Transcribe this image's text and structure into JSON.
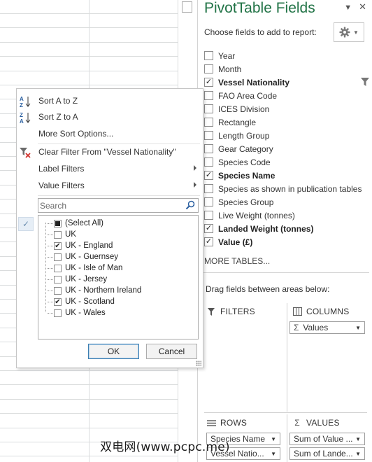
{
  "pivot_panel": {
    "title": "PivotTable Fields",
    "choose_text": "Choose fields to add to report:",
    "fields": [
      {
        "label": "Year",
        "checked": false,
        "bold": false
      },
      {
        "label": "Month",
        "checked": false,
        "bold": false
      },
      {
        "label": "Vessel Nationality",
        "checked": true,
        "bold": true,
        "filtered": true
      },
      {
        "label": "FAO Area Code",
        "checked": false,
        "bold": false
      },
      {
        "label": "ICES Division",
        "checked": false,
        "bold": false
      },
      {
        "label": "Rectangle",
        "checked": false,
        "bold": false
      },
      {
        "label": "Length Group",
        "checked": false,
        "bold": false
      },
      {
        "label": "Gear Category",
        "checked": false,
        "bold": false
      },
      {
        "label": "Species Code",
        "checked": false,
        "bold": false
      },
      {
        "label": "Species Name",
        "checked": true,
        "bold": true
      },
      {
        "label": "Species as shown in publication tables",
        "checked": false,
        "bold": false
      },
      {
        "label": "Species Group",
        "checked": false,
        "bold": false
      },
      {
        "label": "Live Weight (tonnes)",
        "checked": false,
        "bold": false
      },
      {
        "label": "Landed Weight (tonnes)",
        "checked": true,
        "bold": true
      },
      {
        "label": "Value (£)",
        "checked": true,
        "bold": true
      }
    ],
    "more_tables": "MORE TABLES...",
    "drag_text": "Drag fields between areas below:",
    "areas": {
      "filters": {
        "label": "FILTERS"
      },
      "columns": {
        "label": "COLUMNS",
        "chips": [
          "Values"
        ]
      },
      "rows": {
        "label": "ROWS",
        "chips": [
          "Species Name",
          "Vessel Natio..."
        ]
      },
      "values": {
        "label": "VALUES",
        "chips": [
          "Sum of Value ...",
          "Sum of Lande..."
        ]
      }
    }
  },
  "filter_menu": {
    "sort_az": "Sort A to Z",
    "sort_za": "Sort Z to A",
    "more_sort": "More Sort Options...",
    "clear_filter": "Clear Filter From \"Vessel Nationality\"",
    "label_filters": "Label Filters",
    "value_filters": "Value Filters",
    "search_placeholder": "Search",
    "values": [
      {
        "label": "(Select All)",
        "state": "partial"
      },
      {
        "label": "UK",
        "state": "unchecked"
      },
      {
        "label": "UK - England",
        "state": "checked"
      },
      {
        "label": "UK - Guernsey",
        "state": "unchecked"
      },
      {
        "label": "UK - Isle of Man",
        "state": "unchecked"
      },
      {
        "label": "UK - Jersey",
        "state": "unchecked"
      },
      {
        "label": "UK - Northern Ireland",
        "state": "unchecked"
      },
      {
        "label": "UK - Scotland",
        "state": "checked"
      },
      {
        "label": "UK - Wales",
        "state": "unchecked"
      }
    ],
    "ok_label": "OK",
    "cancel_label": "Cancel"
  },
  "watermark": "双电网(www.pcpc.me)",
  "colors": {
    "accent_green": "#217346",
    "ok_border": "#3c7fb1"
  },
  "icons": [
    "sort-az-icon",
    "sort-za-icon",
    "clear-filter-icon",
    "search-icon",
    "gear-icon",
    "funnel-icon",
    "close-icon",
    "checkmark-icon"
  ]
}
